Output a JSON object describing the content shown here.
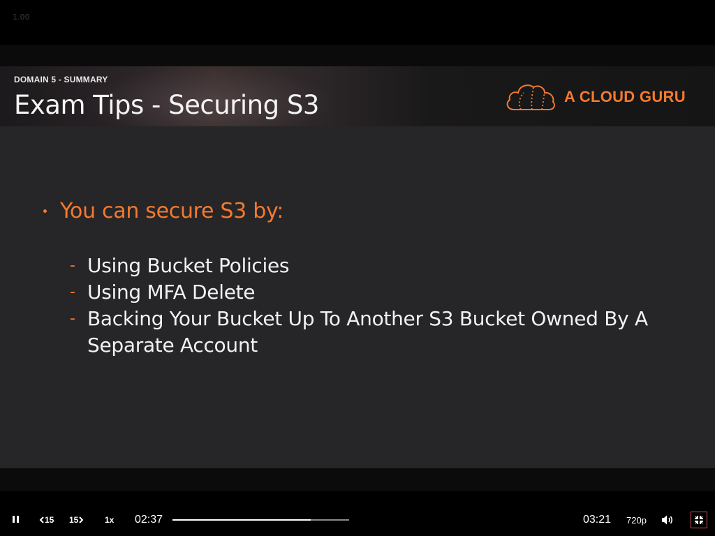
{
  "player": {
    "version_label": "1.00"
  },
  "slide": {
    "domain_label": "DOMAIN 5 - SUMMARY",
    "title": "Exam Tips - Securing S3",
    "logo_text": "A CLOUD GURU",
    "bullet": "You can secure S3 by:",
    "sub_items": [
      "Using Bucket Policies",
      "Using MFA Delete",
      "Backing Your Bucket Up To Another S3 Bucket Owned By A Separate Account"
    ],
    "dash": "-"
  },
  "controls": {
    "skip_back_label": "15",
    "skip_forward_label": "15",
    "speed_label": "1x",
    "current_time": "02:37",
    "total_time": "03:21",
    "progress_fraction": 0.782,
    "quality_label": "720p"
  },
  "colors": {
    "accent": "#f37a2f",
    "slide_bg": "#262527",
    "fullscreen_outline": "#d9534f"
  },
  "icons": {
    "play_pause": "pause-icon",
    "skip_back": "rewind-15-icon",
    "skip_forward": "forward-15-icon",
    "volume": "volume-icon",
    "fullscreen": "exit-fullscreen-icon",
    "logo": "cloud-logo-icon"
  }
}
